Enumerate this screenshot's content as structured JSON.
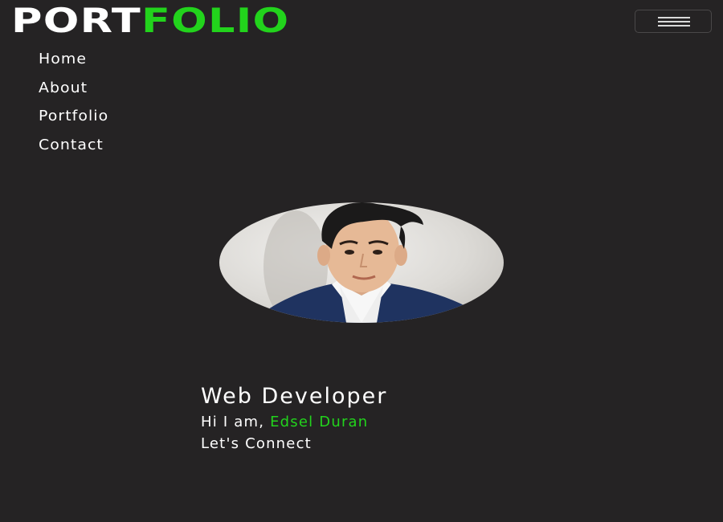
{
  "brand": {
    "part1": "PORT",
    "part2": "FOLIO"
  },
  "colors": {
    "background": "#252324",
    "accent": "#22d31c",
    "text": "#ffffff"
  },
  "navbar": {
    "toggle_icon": "hamburger-menu-icon"
  },
  "nav": {
    "items": [
      {
        "label": "Home"
      },
      {
        "label": "About"
      },
      {
        "label": "Portfolio"
      },
      {
        "label": "Contact"
      }
    ]
  },
  "hero": {
    "role": "Web Developer",
    "greeting": "Hi I am, ",
    "name": "Edsel Duran",
    "cta": "Let's Connect"
  }
}
